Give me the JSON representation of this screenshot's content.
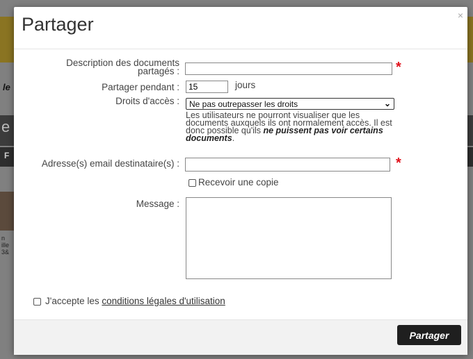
{
  "background": {
    "text_fragments": [
      "le",
      "e",
      "F",
      "n",
      "ille",
      "3&"
    ]
  },
  "modal": {
    "title": "Partager",
    "close_label": "×"
  },
  "form": {
    "description_label_line1": "Description des documents",
    "description_label_line2": "partagés :",
    "description_value": "",
    "required_mark": "*",
    "duration_label": "Partager pendant :",
    "duration_value": "15",
    "duration_unit": "jours",
    "rights_label": "Droits d'accès :",
    "rights_selected": "Ne pas outrepasser les droits",
    "rights_help_line1": "Les utilisateurs ne pourront visualiser que les",
    "rights_help_line2": "documents auxquels ils ont normalement accès. Il est",
    "rights_help_line3_plain": "donc possible qu'ils ",
    "rights_help_line3_bold": "ne puissent pas voir certains",
    "rights_help_line4_bold": "documents",
    "rights_help_line4_end": ".",
    "emails_label": "Adresse(s) email destinataire(s) :",
    "emails_value": "",
    "copy_checkbox_label": "Recevoir une copie",
    "copy_checked": false,
    "message_label": "Message :",
    "message_value": "",
    "terms_prefix": "J'accepte les ",
    "terms_link": "conditions légales d'utilisation",
    "terms_checked": false
  },
  "footer": {
    "submit_label": "Partager"
  }
}
